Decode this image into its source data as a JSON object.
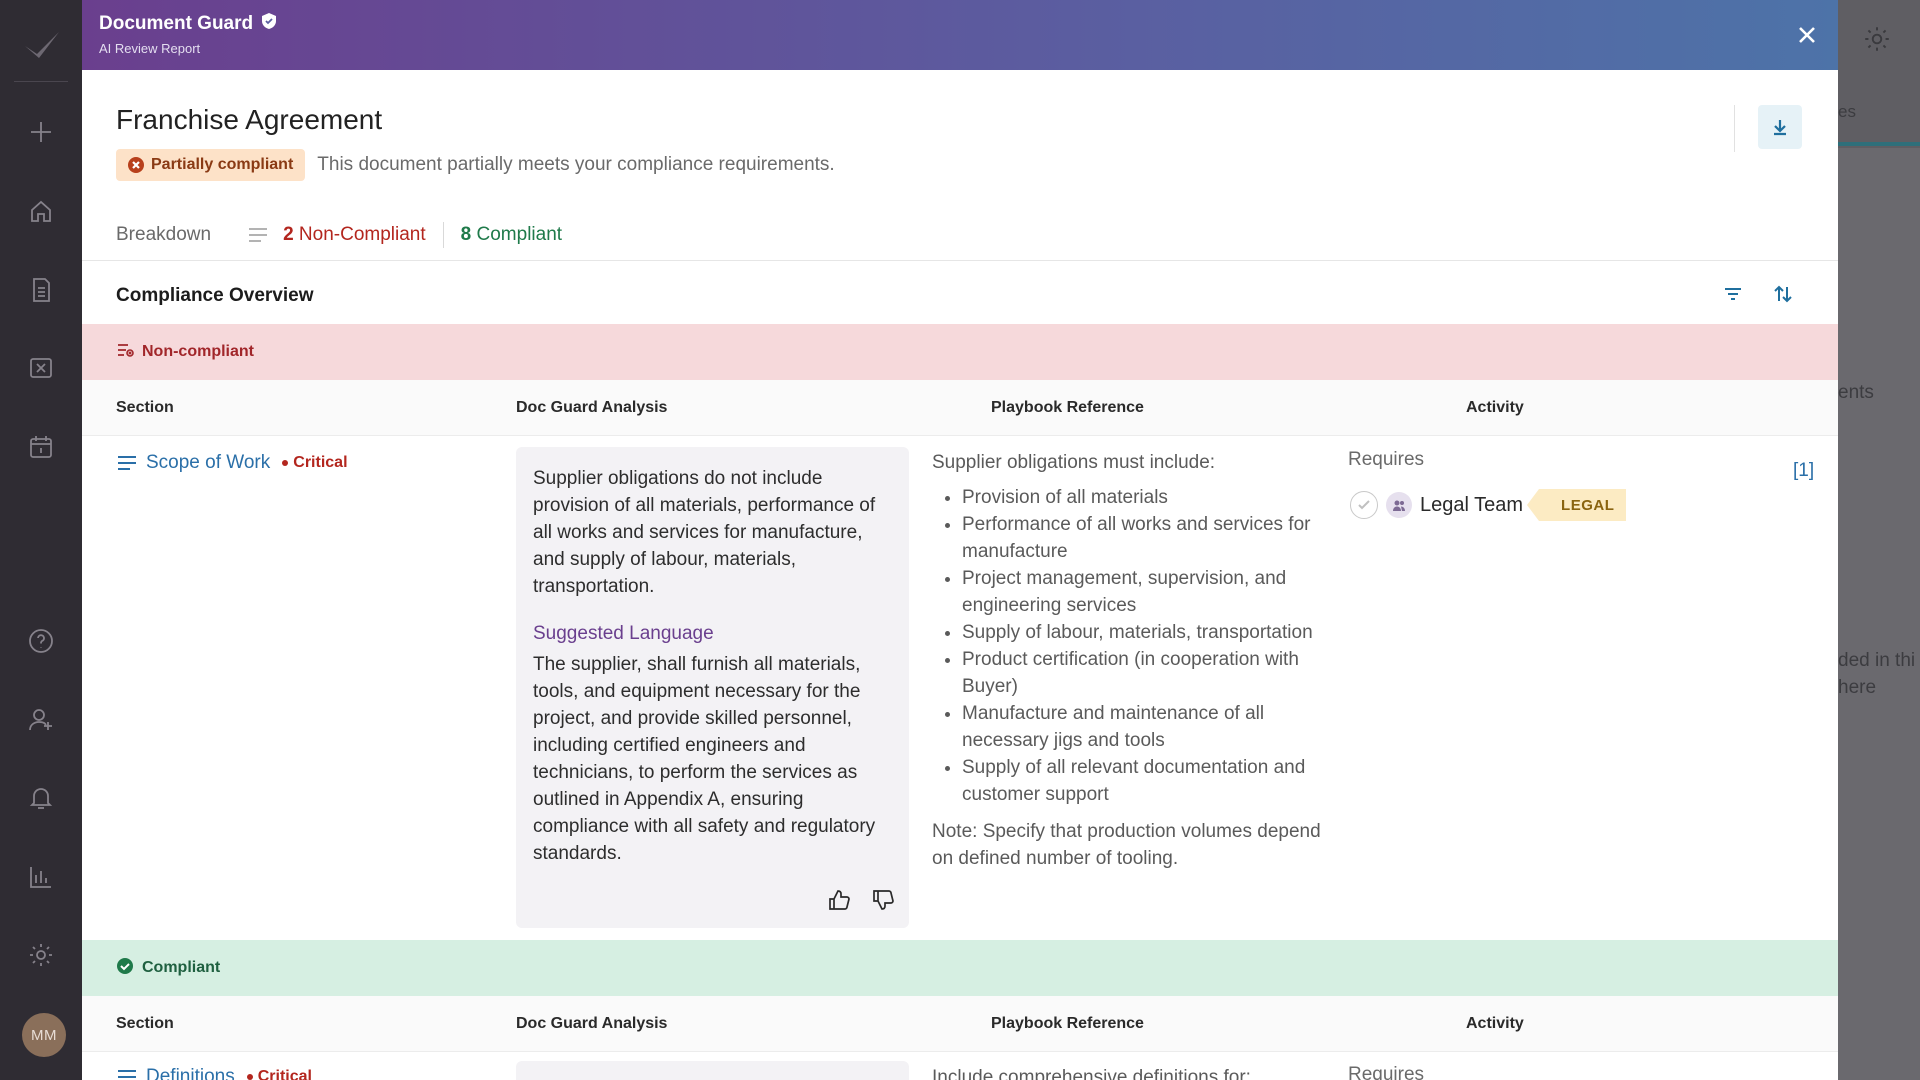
{
  "sidebar": {
    "avatar_initials": "MM",
    "icons": [
      "logo-icon",
      "plus-icon",
      "home-icon",
      "document-icon",
      "review-icon",
      "calendar-icon",
      "help-icon",
      "add-user-icon",
      "bell-icon",
      "chart-icon",
      "gear-icon"
    ]
  },
  "background": {
    "fragments": [
      "es",
      "ents",
      "ded in thi",
      "here"
    ]
  },
  "modal": {
    "title": "Document Guard",
    "subtitle": "AI Review Report",
    "doc_title": "Franchise Agreement",
    "status_label": "Partially compliant",
    "status_text": "This document partially meets your compliance requirements.",
    "breakdown_label": "Breakdown",
    "noncompliant_count": "2",
    "noncompliant_label": "Non-Compliant",
    "compliant_count": "8",
    "compliant_label": "Compliant",
    "overview_title": "Compliance Overview"
  },
  "columns": {
    "section": "Section",
    "analysis": "Doc Guard Analysis",
    "playbook": "Playbook Reference",
    "activity": "Activity"
  },
  "groups": {
    "noncompliant_label": "Non-compliant",
    "compliant_label": "Compliant"
  },
  "rows": [
    {
      "section": "Scope of Work",
      "severity": "Critical",
      "analysis": "Supplier obligations do not include provision of all materials, performance of all works and services for manufacture, and supply of labour, materials, transportation.",
      "suggested_heading": "Suggested Language",
      "suggested_text": "The supplier, shall furnish all materials, tools, and equipment necessary for the project, and provide skilled personnel, including certified engineers and technicians, to perform the services as outlined in Appendix A, ensuring compliance with all safety and regulatory standards.",
      "playbook_intro": "Supplier obligations must include:",
      "playbook_items": [
        "Provision of all materials",
        "Performance of all works and services for manufacture",
        "Project management, supervision, and engineering services",
        "Supply of labour, materials, transportation",
        "Product certification (in cooperation with Buyer)",
        "Manufacture and maintenance of all necessary jigs and tools",
        "Supply of all relevant documentation and customer support"
      ],
      "playbook_note": "Note: Specify that production volumes depend on defined number of tooling.",
      "activity_label": "Requires",
      "assignee": "Legal Team",
      "tag": "LEGAL",
      "ref": "[1]"
    },
    {
      "section": "Definitions",
      "severity": "Critical",
      "playbook_intro": "Include comprehensive definitions for:",
      "activity_label": "Requires"
    }
  ]
}
